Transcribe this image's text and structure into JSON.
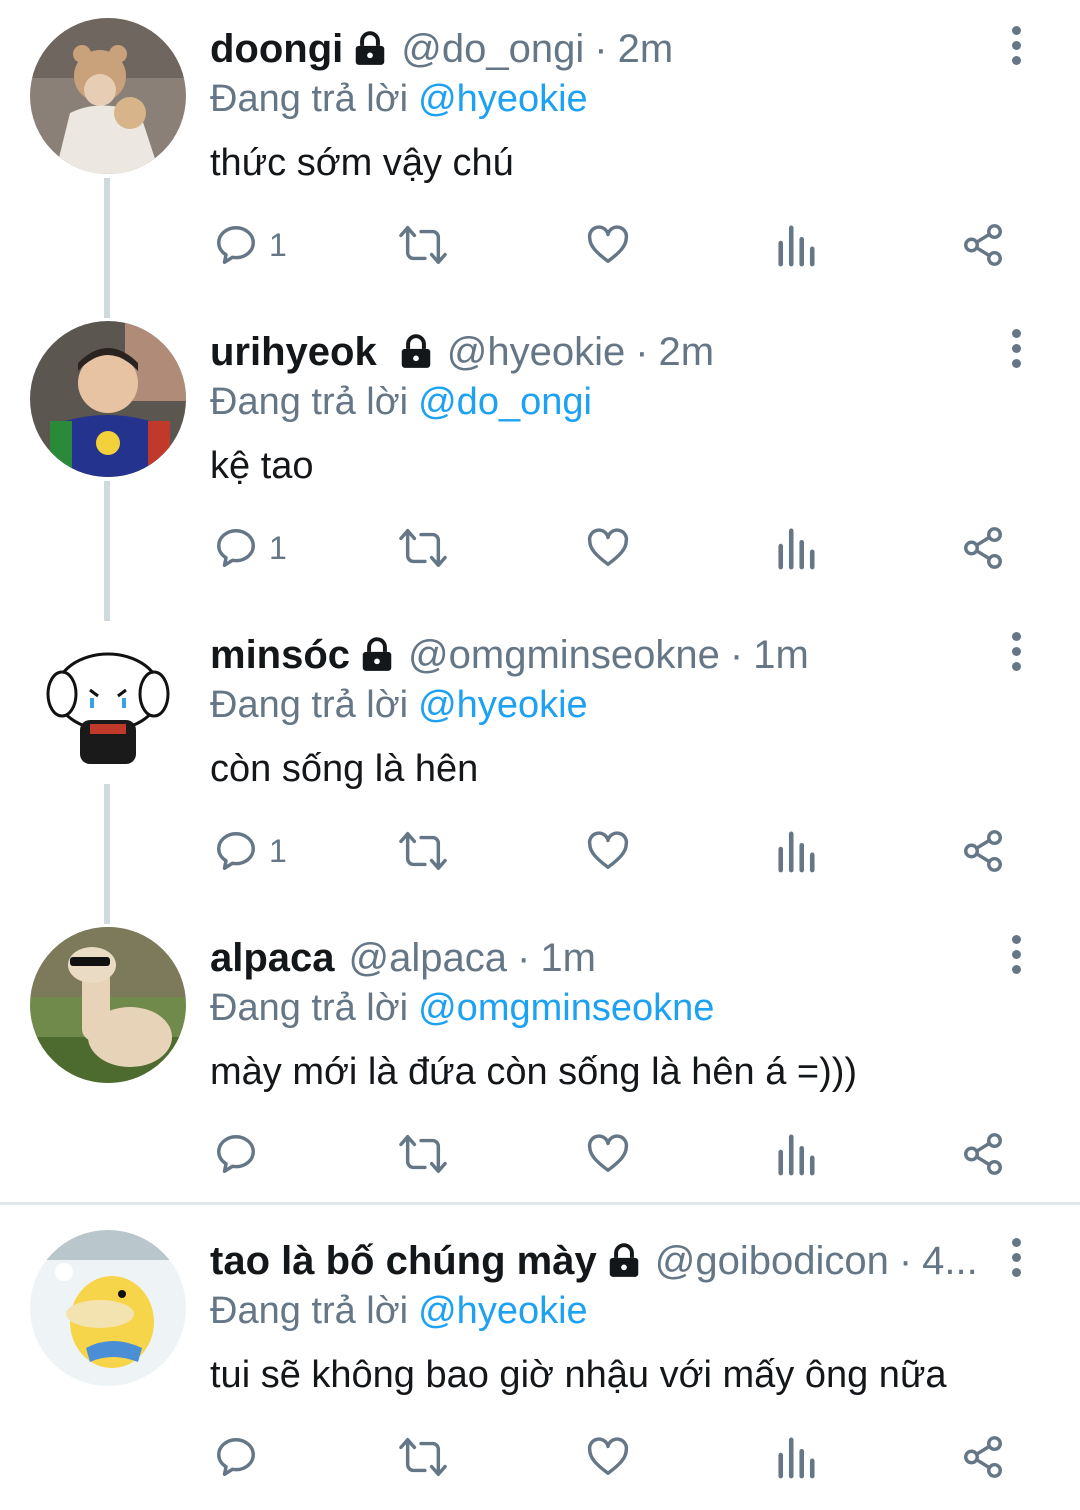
{
  "tweets": [
    {
      "name": "doongi",
      "locked": true,
      "handle": "@do_ongi",
      "separator": "·",
      "time": "2m",
      "reply_prefix": "Đang trả lời",
      "reply_to": "@hyeokie",
      "text": "thức sớm vậy chú",
      "reply_count": "1"
    },
    {
      "name": "urihyeok",
      "locked": true,
      "handle": "@hyeokie",
      "separator": "·",
      "time": "2m",
      "reply_prefix": "Đang trả lời",
      "reply_to": "@do_ongi",
      "text": "kệ tao",
      "reply_count": "1"
    },
    {
      "name": "minsóc",
      "locked": true,
      "handle": "@omgminseokne",
      "separator": "·",
      "time": "1m",
      "reply_prefix": "Đang trả lời",
      "reply_to": "@hyeokie",
      "text": "còn sống là hên",
      "reply_count": "1"
    },
    {
      "name": "alpaca",
      "locked": false,
      "handle": "@alpaca",
      "separator": "·",
      "time": "1m",
      "reply_prefix": "Đang trả lời",
      "reply_to": "@omgminseokne",
      "text": "mày mới là đứa còn sống là hên á =)))",
      "reply_count": ""
    },
    {
      "name": "tao là bố chúng mày",
      "locked": true,
      "handle": "@goibodicon",
      "separator": "·",
      "time": "4...",
      "reply_prefix": "Đang trả lời",
      "reply_to": "@hyeokie",
      "text": "tui sẽ không bao giờ nhậu với mấy ông nữa",
      "reply_count": ""
    }
  ],
  "icons": {
    "reply": "reply-icon",
    "retweet": "retweet-icon",
    "like": "heart-icon",
    "analytics": "analytics-icon",
    "share": "share-icon",
    "more": "more-vertical-icon",
    "lock": "lock-icon"
  },
  "colors": {
    "text": "#14171a",
    "secondary": "#657786",
    "link": "#1da1f2",
    "thread_line": "#cfd9de"
  }
}
